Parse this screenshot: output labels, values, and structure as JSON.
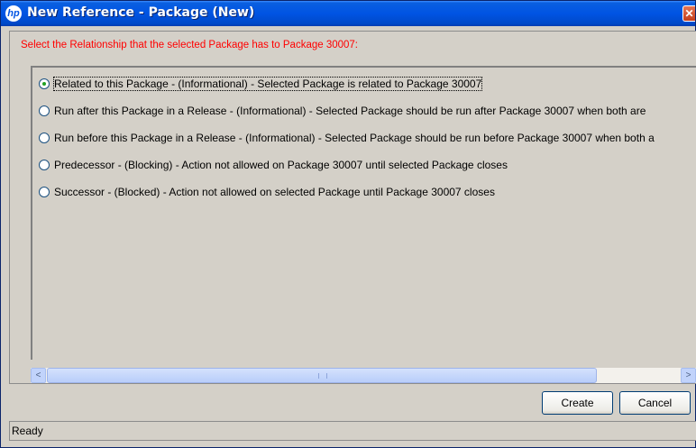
{
  "window": {
    "title": "New Reference - Package (New)",
    "logo_text": "hp",
    "close_glyph": "✕"
  },
  "prompt": "Select the Relationship that the selected Package has to Package 30007:",
  "options": [
    {
      "label": "Related to this Package - (Informational) - Selected Package is related to Package 30007",
      "selected": true
    },
    {
      "label": "Run after this Package in a Release - (Informational) - Selected Package should be run after Package 30007 when both are",
      "selected": false
    },
    {
      "label": "Run before this Package in a Release - (Informational) - Selected Package should be run before Package 30007 when both a",
      "selected": false
    },
    {
      "label": "Predecessor - (Blocking) - Action not allowed on Package 30007 until selected Package closes",
      "selected": false
    },
    {
      "label": "Successor - (Blocked) - Action not allowed on selected Package until Package 30007 closes",
      "selected": false
    }
  ],
  "scrollbar": {
    "left_arrow": "<",
    "right_arrow": ">"
  },
  "buttons": {
    "create": "Create",
    "cancel": "Cancel"
  },
  "status": "Ready"
}
